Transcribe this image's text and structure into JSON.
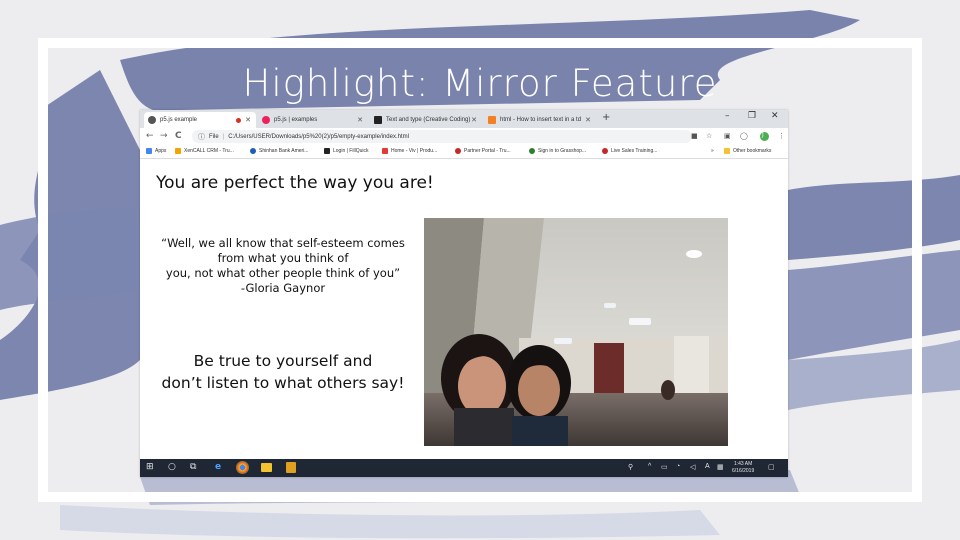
{
  "slide": {
    "title": "Highlight: Mirror Feature"
  },
  "browser": {
    "tabs": [
      {
        "label": "p5.js example"
      },
      {
        "label": "p5.js | examples"
      },
      {
        "label": "Text and type (Creative Coding)"
      },
      {
        "label": "html - How to insert text in a td"
      }
    ],
    "new_tab": "+",
    "window_controls": {
      "minimize": "–",
      "restore": "❐",
      "close": "✕"
    },
    "nav": {
      "back": "←",
      "forward": "→",
      "reload": "C"
    },
    "address": {
      "scheme_label": "File",
      "url": "C:/Users/USER/Downloads/p5%20(2)/p5/empty-example/index.html"
    },
    "profile_initial": "J",
    "bookmarks": [
      {
        "label": "Apps"
      },
      {
        "label": "XenCALL CRM - Tru..."
      },
      {
        "label": "Shinhan Bank Ameri..."
      },
      {
        "label": "Login | FillQuick"
      },
      {
        "label": "Home - Viv | Produ..."
      },
      {
        "label": "Partner Portal - Tru..."
      },
      {
        "label": "Sign in to Grasshop..."
      },
      {
        "label": "Live Sales Training..."
      }
    ],
    "bookmarks_more": "»",
    "other_bookmarks": "Other bookmarks"
  },
  "page": {
    "heading": "You are perfect the way you are!",
    "quote_lines": [
      "“Well, we all know that self-esteem comes",
      "from what you think of",
      "you, not what other people think of you”",
      "-Gloria Gaynor"
    ],
    "advice_lines": [
      "Be true to yourself and",
      "don’t listen to what others say!"
    ]
  },
  "taskbar": {
    "time": "1:43 AM",
    "date": "6/16/2019",
    "input_language": "A"
  },
  "colors": {
    "brush": "#6f7aa6",
    "tabbar": "#dee1e6",
    "taskbar": "#1e2733"
  }
}
